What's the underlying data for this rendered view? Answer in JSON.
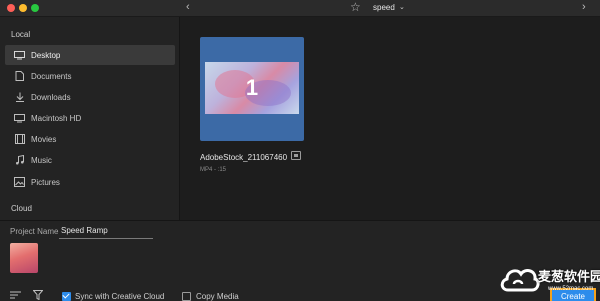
{
  "titlebar": {
    "back_glyph": "‹",
    "forward_glyph": "›",
    "folder_name": "speed",
    "folder_chevron": "⌄"
  },
  "sidebar": {
    "local_label": "Local",
    "cloud_label": "Cloud",
    "items": [
      {
        "label": "Desktop",
        "icon": "desktop-icon"
      },
      {
        "label": "Documents",
        "icon": "documents-icon"
      },
      {
        "label": "Downloads",
        "icon": "download-icon"
      },
      {
        "label": "Macintosh HD",
        "icon": "hard-drive-icon"
      },
      {
        "label": "Movies",
        "icon": "film-icon"
      },
      {
        "label": "Music",
        "icon": "music-icon"
      },
      {
        "label": "Pictures",
        "icon": "pictures-icon"
      }
    ],
    "active_index": 0
  },
  "media": {
    "items": [
      {
        "thumb_number": "1",
        "name": "AdobeStock_211067460",
        "meta": "MP4 - :15"
      }
    ]
  },
  "bottom": {
    "project_name_label": "Project Name",
    "project_name_value": "Speed Ramp",
    "sync_label": "Sync with Creative Cloud",
    "sync_checked": true,
    "copy_label": "Copy Media",
    "copy_checked": false,
    "create_label": "Create"
  },
  "watermark": {
    "text": "麦葱软件园",
    "url": "www.52mac.com"
  },
  "colors": {
    "accent": "#2d8ceb",
    "tile_bg": "#3c6aa6",
    "highlight_border": "#f3a21b"
  }
}
